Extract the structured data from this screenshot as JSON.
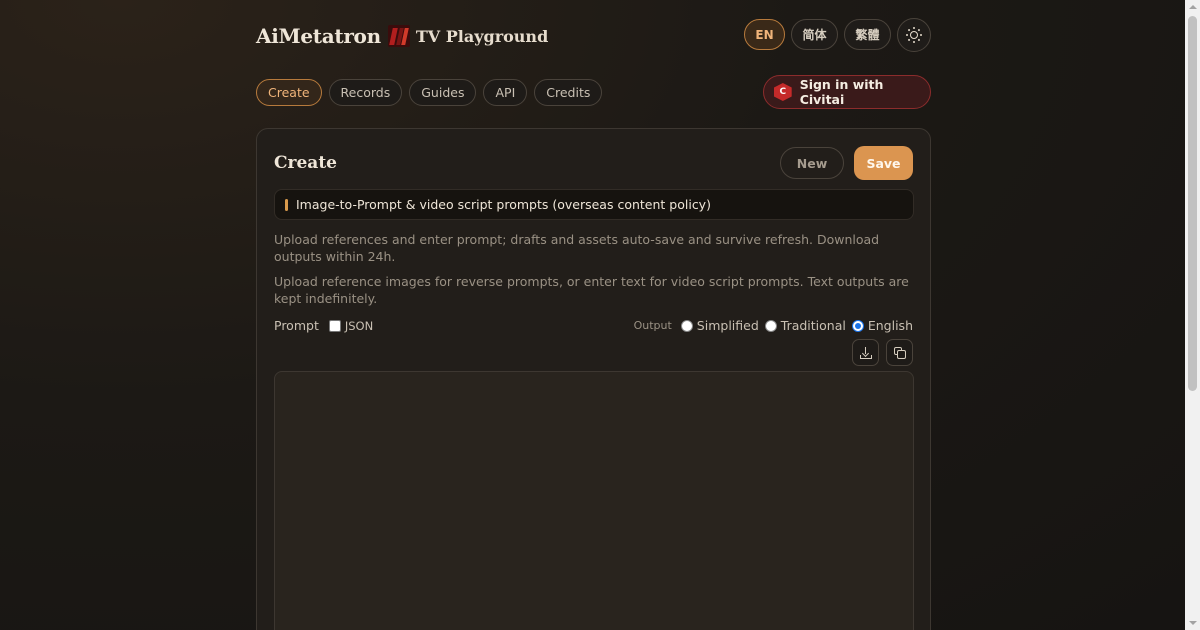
{
  "header": {
    "brand_name": "AiMetatron",
    "brand_subtitle": "TV Playground",
    "languages": [
      "EN",
      "简体",
      "繁體"
    ],
    "active_language": "EN"
  },
  "nav": {
    "items": [
      "Create",
      "Records",
      "Guides",
      "API",
      "Credits"
    ],
    "active": "Create",
    "sign_in_label": "Sign in with Civitai",
    "sign_in_icon_letter": "C"
  },
  "card": {
    "title": "Create",
    "new_label": "New",
    "save_label": "Save",
    "notice": "Image-to-Prompt & video script prompts (overseas content policy)",
    "description_1": "Upload references and enter prompt; drafts and assets auto-save and survive refresh. Download outputs within 24h.",
    "description_2": "Upload reference images for reverse prompts, or enter text for video script prompts. Text outputs are kept indefinitely.",
    "prompt_label": "Prompt",
    "json_label": "JSON",
    "json_checked": false,
    "output_label": "Output",
    "output_options": [
      "Simplified",
      "Traditional",
      "English"
    ],
    "output_selected": "English",
    "prompt_value": ""
  },
  "colors": {
    "accent": "#db9550",
    "active_border": "#b77a3c",
    "civitai_red": "#c52a2a"
  },
  "icons": {
    "theme_toggle": "sun-icon",
    "download": "download-icon",
    "copy": "copy-icon"
  }
}
